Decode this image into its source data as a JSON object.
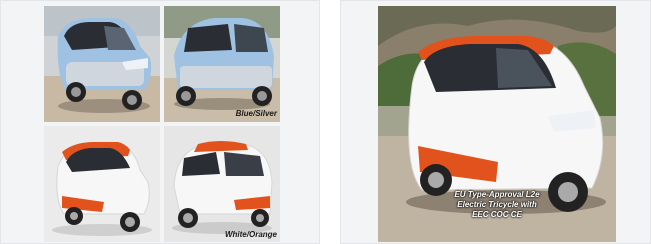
{
  "images": {
    "blue": {
      "label": "Blue/Silver",
      "alt": "blue-silver-electric-tricycle"
    },
    "white": {
      "label": "White/Orange",
      "alt": "white-orange-electric-tricycle"
    },
    "hero": {
      "caption_lines": [
        "EU Type-Approval L2e",
        "Electric Tricycle with",
        "EEC COC CE"
      ]
    }
  },
  "colors": {
    "body_blue": "#9fc1e2",
    "body_silver": "#cfd6de",
    "body_white": "#f7f7f7",
    "accent_orange": "#e2521c",
    "roof_dark": "#2a2d33",
    "ground": "#d9cfc2"
  }
}
